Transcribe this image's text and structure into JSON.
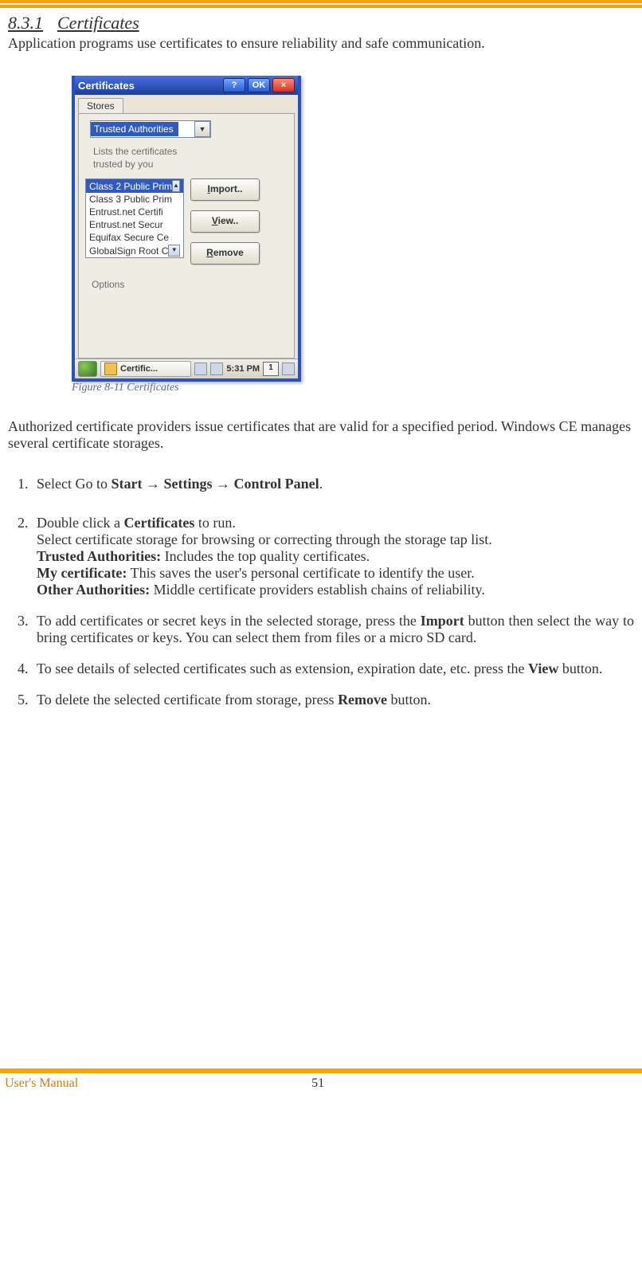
{
  "header": {
    "section_number": "8.3.1",
    "section_title": "Certificates",
    "intro": "Application programs use certificates to ensure reliability and safe communication."
  },
  "figure": {
    "caption": "Figure 8-11 Certificates",
    "dialog": {
      "title": "Certificates",
      "help": "?",
      "ok": "OK",
      "close": "×",
      "tab": "Stores",
      "combo_selected": "Trusted Authorities",
      "hint_line1": "Lists the certificates",
      "hint_line2": "trusted by you",
      "list": [
        "Class 2 Public Prim",
        "Class 3 Public Prim",
        "Entrust.net Certifi",
        "Entrust.net Secur",
        "Equifax Secure Ce",
        "GlobalSign Root C"
      ],
      "btn_import": "mport..",
      "btn_import_u": "I",
      "btn_view": "iew..",
      "btn_view_u": "V",
      "btn_remove": "emove",
      "btn_remove_u": "R",
      "options": "Options",
      "task_app": "Certific...",
      "time": "5:31 PM",
      "kbd": "1"
    }
  },
  "paragraphs": {
    "p1": "Authorized certificate providers issue certificates that are valid for a specified period. Windows CE manages several certificate storages."
  },
  "steps": {
    "s1_pre": "Select Go to ",
    "s1_b1": "Start",
    "s1_arrow": " → ",
    "s1_b2": "Settings",
    "s1_b3": "Control Panel",
    "s1_end": ".",
    "s2_l1_pre": "Double click a ",
    "s2_l1_b": "Certificates",
    "s2_l1_post": " to run.",
    "s2_l2": "Select certificate storage for browsing or correcting through the storage tap list.",
    "s2_l3_b": "Trusted Authorities:",
    "s2_l3": " Includes the top quality certificates.",
    "s2_l4_b": "My certificate:",
    "s2_l4": " This saves the user's personal certificate to identify the user.",
    "s2_l5_b": "Other Authorities:",
    "s2_l5": " Middle certificate providers establish chains of reliability.",
    "s3_pre": "To add certificates or secret keys in the selected storage, press the ",
    "s3_b": "Import",
    "s3_post": " button then select the way to bring certificates or keys. You can select them from files or a micro SD card.",
    "s4_pre": "To see details of selected certificates such as extension, expiration date, etc. press the ",
    "s4_b": "View",
    "s4_post": " button.",
    "s5_pre": "To delete the selected certificate from storage, press ",
    "s5_b": "Remove",
    "s5_post": " button."
  },
  "footer": {
    "left": "User's Manual",
    "page": "51"
  }
}
